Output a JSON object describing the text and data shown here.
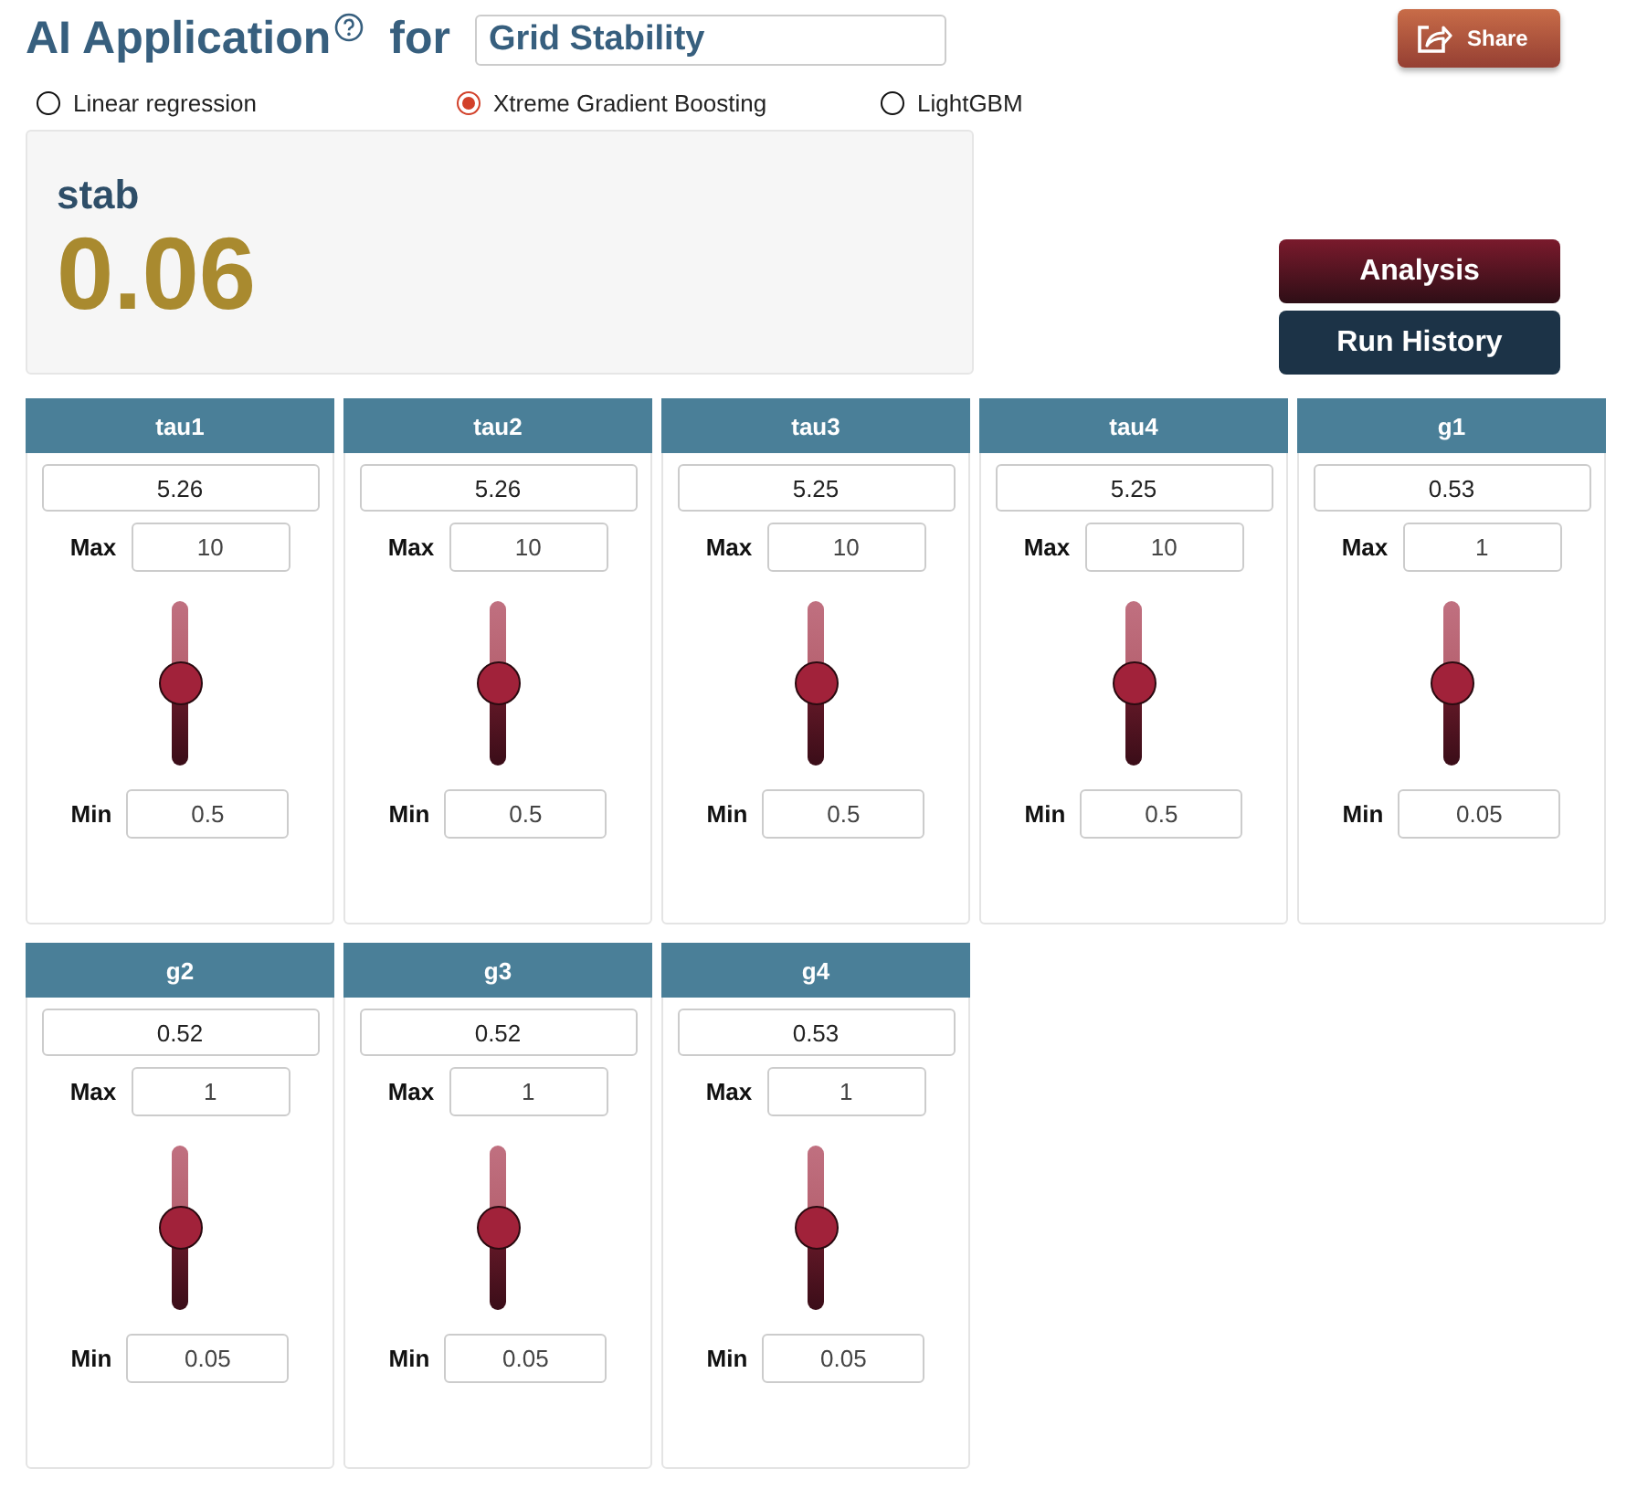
{
  "header": {
    "title": "AI Application",
    "connector": "for",
    "application": "Grid Stability",
    "share_label": "Share"
  },
  "models": [
    {
      "label": "Linear regression",
      "selected": false
    },
    {
      "label": "Xtreme Gradient Boosting",
      "selected": true
    },
    {
      "label": "LightGBM",
      "selected": false
    }
  ],
  "result": {
    "name": "stab",
    "value": "0.06"
  },
  "actions": [
    "Analysis",
    "Run History"
  ],
  "parameters": [
    {
      "name": "tau1",
      "value": "5.26",
      "max_label": "Max",
      "max": "10",
      "min_label": "Min",
      "min": "0.5",
      "level": 0.5
    },
    {
      "name": "tau2",
      "value": "5.26",
      "max_label": "Max",
      "max": "10",
      "min_label": "Min",
      "min": "0.5",
      "level": 0.5
    },
    {
      "name": "tau3",
      "value": "5.25",
      "max_label": "Max",
      "max": "10",
      "min_label": "Min",
      "min": "0.5",
      "level": 0.5
    },
    {
      "name": "tau4",
      "value": "5.25",
      "max_label": "Max",
      "max": "10",
      "min_label": "Min",
      "min": "0.5",
      "level": 0.5
    },
    {
      "name": "g1",
      "value": "0.53",
      "max_label": "Max",
      "max": "1",
      "min_label": "Min",
      "min": "0.05",
      "level": 0.5
    },
    {
      "name": "g2",
      "value": "0.52",
      "max_label": "Max",
      "max": "1",
      "min_label": "Min",
      "min": "0.05",
      "level": 0.5
    },
    {
      "name": "g3",
      "value": "0.52",
      "max_label": "Max",
      "max": "1",
      "min_label": "Min",
      "min": "0.05",
      "level": 0.5
    },
    {
      "name": "g4",
      "value": "0.53",
      "max_label": "Max",
      "max": "1",
      "min_label": "Min",
      "min": "0.05",
      "level": 0.5
    }
  ]
}
